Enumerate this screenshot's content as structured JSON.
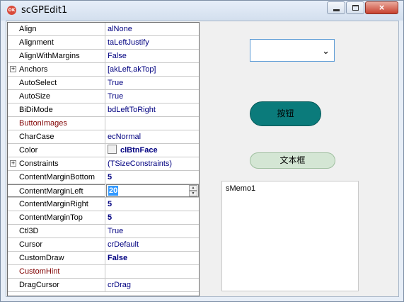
{
  "window": {
    "title": "scGPEdit1",
    "app_icon_text": "OK",
    "close_glyph": "×"
  },
  "inspector": {
    "rows": [
      {
        "name": "Align",
        "value": "alNone"
      },
      {
        "name": "Alignment",
        "value": "taLeftJustify"
      },
      {
        "name": "AlignWithMargins",
        "value": "False"
      },
      {
        "name": "Anchors",
        "value": "[akLeft,akTop]",
        "expandable": true
      },
      {
        "name": "AutoSelect",
        "value": "True"
      },
      {
        "name": "AutoSize",
        "value": "True"
      },
      {
        "name": "BiDiMode",
        "value": "bdLeftToRight"
      },
      {
        "name": "ButtonImages",
        "value": "",
        "highlight": true
      },
      {
        "name": "CharCase",
        "value": "ecNormal"
      },
      {
        "name": "Color",
        "value": "clBtnFace",
        "swatch": "#f0f0f0",
        "bold": true
      },
      {
        "name": "Constraints",
        "value": "(TSizeConstraints)",
        "expandable": true
      },
      {
        "name": "ContentMarginBottom",
        "value": "5",
        "bold": true
      },
      {
        "name": "ContentMarginLeft",
        "value": "20",
        "editing": true
      },
      {
        "name": "ContentMarginRight",
        "value": "5",
        "bold": true
      },
      {
        "name": "ContentMarginTop",
        "value": "5",
        "bold": true
      },
      {
        "name": "Ctl3D",
        "value": "True"
      },
      {
        "name": "Cursor",
        "value": "crDefault"
      },
      {
        "name": "CustomDraw",
        "value": "False",
        "bold": true
      },
      {
        "name": "CustomHint",
        "value": "",
        "highlight": true
      },
      {
        "name": "DragCursor",
        "value": "crDrag"
      }
    ],
    "expand_glyph": "+"
  },
  "designer": {
    "combo_value": "",
    "combo_arrow": "⌄",
    "button_label": "按钮",
    "textbox_label": "文本框",
    "memo_text": "sMemo1"
  },
  "colors": {
    "teal_button": "#0b7b7b",
    "green_button": "#d4e6d4",
    "value_text": "#000080",
    "highlight_name": "#800000",
    "selection": "#3399ff"
  }
}
